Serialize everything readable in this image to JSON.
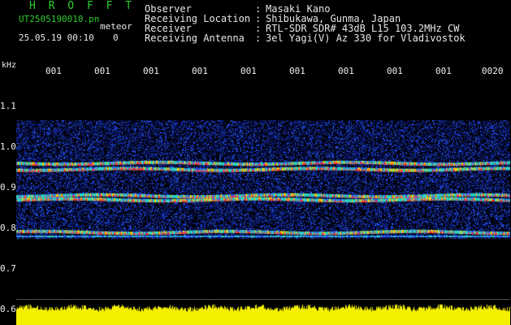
{
  "header": {
    "brand": "H R O F F T",
    "filename": "UT2505190010.pn",
    "meteor_label": "meteor",
    "datetime": "25.05.19 00:10",
    "meteor_count": "0"
  },
  "station_info": [
    {
      "key": "Observer",
      "value": "Masaki Kano"
    },
    {
      "key": "Receiving Location",
      "value": "Shibukawa, Gunma, Japan"
    },
    {
      "key": "Receiver",
      "value": "RTL-SDR SDR# 43dB L15 103.2MHz CW"
    },
    {
      "key": "Receiving Antenna",
      "value": "3el Yagi(V) Az 330 for Vladivostok"
    }
  ],
  "separator": ":",
  "axis": {
    "unit": "kHz",
    "y_ticks": [
      "1.1",
      "1.0",
      "0.9",
      "0.8",
      "0.7",
      "0.6"
    ],
    "x_ticks": [
      "001",
      "001",
      "001",
      "001",
      "001",
      "001",
      "001",
      "001",
      "001",
      "0020"
    ]
  },
  "spectrogram": {
    "freq_range_khz": [
      0.6,
      1.15
    ],
    "bands_khz": [
      0.96,
      0.945,
      0.88,
      0.87,
      0.79
    ],
    "colors": {
      "background": "#000000",
      "noise_low": "#0a1a8c",
      "noise_mid": "#2a5cff",
      "mid": "#2fd0c0",
      "high": "#ffd400",
      "peak": "#ff3030",
      "scope": "#f5f000"
    }
  }
}
